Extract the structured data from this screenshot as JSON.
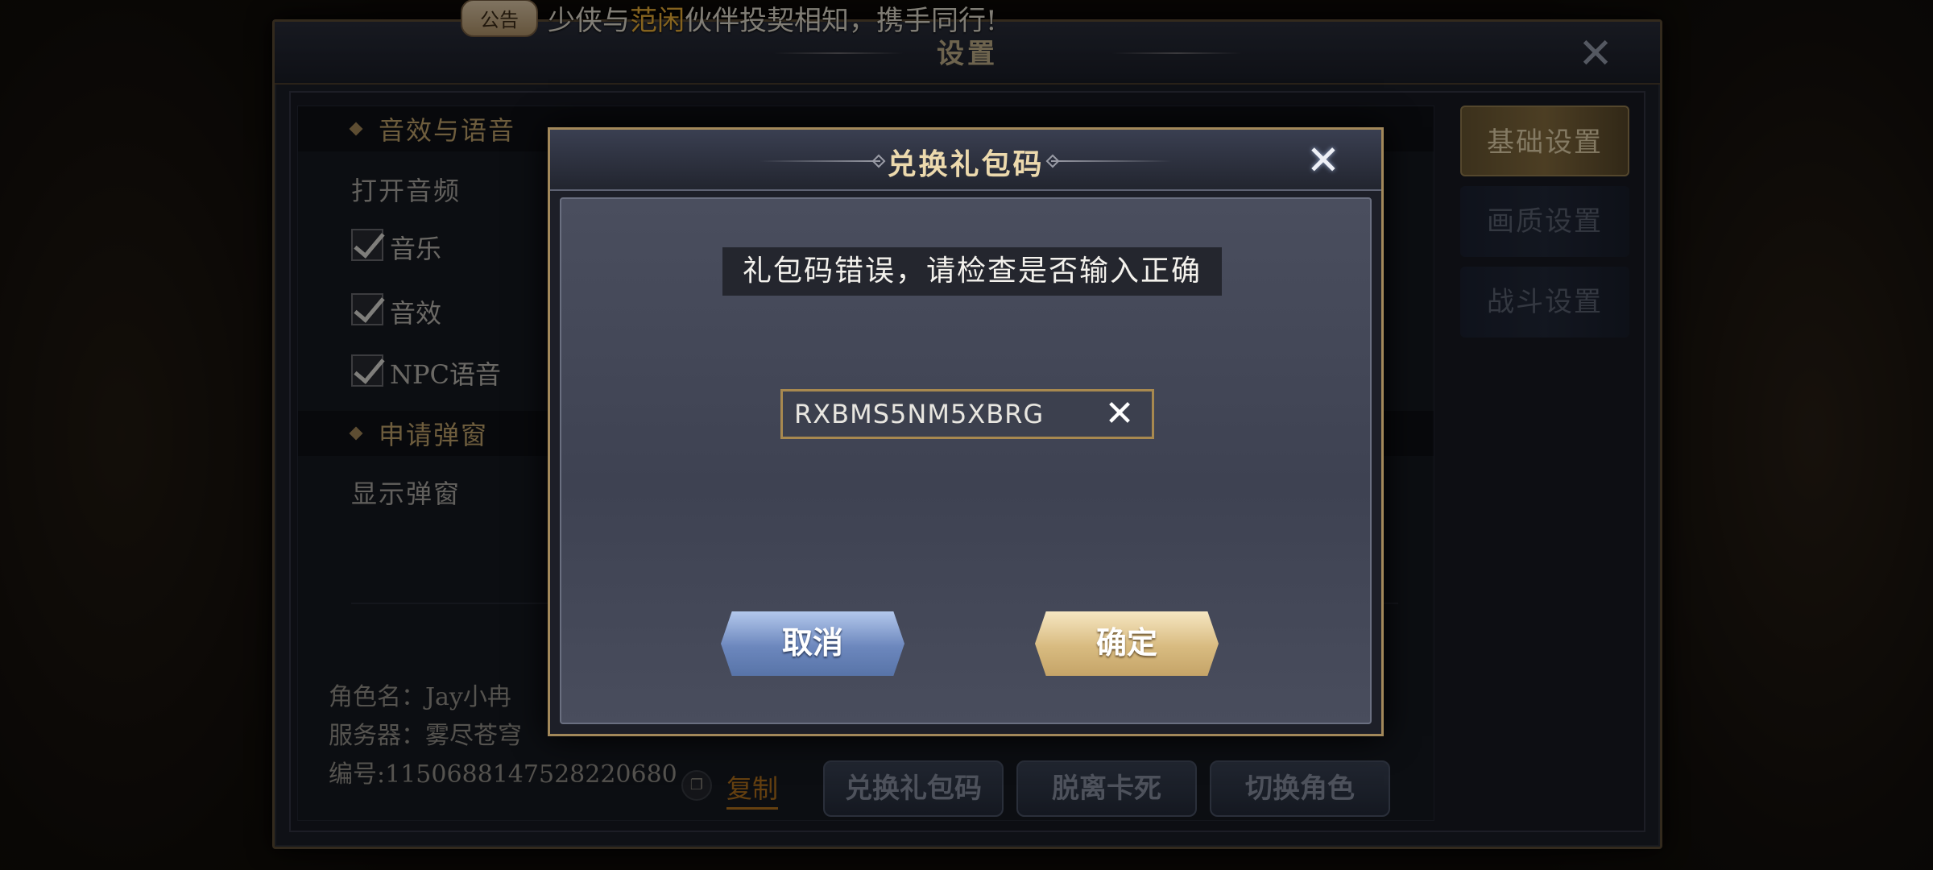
{
  "notice": {
    "tag": "公告",
    "text_part1": "少侠与",
    "text_highlight": "范闲",
    "text_part2": "伙伴投契相知，携手同行!"
  },
  "settings": {
    "title": "设置",
    "sections": {
      "audio": {
        "title": "音效与语音",
        "open_audio_label": "打开音频",
        "music_label": "音乐",
        "music_checked": true,
        "sfx_label": "音效",
        "sfx_checked": true,
        "npc_voice_label": "NPC语音",
        "npc_voice_checked": true
      },
      "popup": {
        "title": "申请弹窗",
        "show_popup_label": "显示弹窗"
      }
    },
    "account": {
      "role_name": "角色名：Jay小冉",
      "server": "服务器：雾尽苍穹",
      "id": "编号:1150688147528220680",
      "copy_label": "复制"
    },
    "bottom_buttons": [
      "兑换礼包码",
      "脱离卡死",
      "切换角色"
    ],
    "side_tabs": [
      {
        "label": "基础设置",
        "active": true
      },
      {
        "label": "画质设置",
        "active": false
      },
      {
        "label": "战斗设置",
        "active": false
      }
    ]
  },
  "dialog": {
    "title": "兑换礼包码",
    "error_message": "礼包码错误，请检查是否输入正确",
    "code_value": "RXBMS5NM5XBRG",
    "cancel_label": "取消",
    "confirm_label": "确定"
  },
  "colors": {
    "gold_accent": "#c8a96f",
    "highlight": "#f2b53a",
    "copy_link": "#b8751e",
    "cancel_button": "#6c87bd",
    "confirm_button": "#d8bb80"
  },
  "icons": {
    "settings_close": "close-icon",
    "dialog_close": "close-icon",
    "clear_code": "clear-icon",
    "copy": "copy-icon"
  }
}
